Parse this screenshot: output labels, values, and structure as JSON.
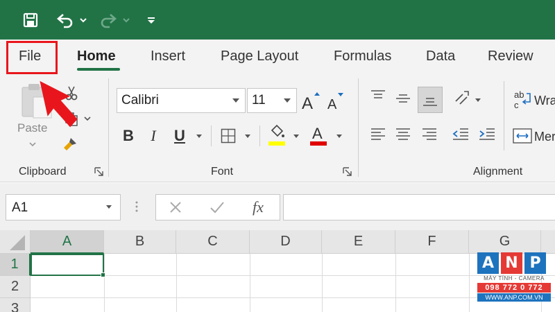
{
  "tabs": [
    {
      "label": "File",
      "active": false
    },
    {
      "label": "Home",
      "active": true
    },
    {
      "label": "Insert",
      "active": false
    },
    {
      "label": "Page Layout",
      "active": false
    },
    {
      "label": "Formulas",
      "active": false
    },
    {
      "label": "Data",
      "active": false
    },
    {
      "label": "Review",
      "active": false
    }
  ],
  "ribbon": {
    "clipboard": {
      "paste_label": "Paste",
      "group_label": "Clipboard"
    },
    "font": {
      "font_name": "Calibri",
      "font_size": "11",
      "group_label": "Font"
    },
    "alignment": {
      "wrap_label": "Wra",
      "merge_label": "Mer",
      "group_label": "Alignment"
    }
  },
  "formula_bar": {
    "name_box": "A1",
    "fx_label": "fx",
    "formula": ""
  },
  "grid": {
    "columns": [
      "A",
      "B",
      "C",
      "D",
      "E",
      "F",
      "G"
    ],
    "rows": [
      "1",
      "2",
      "3"
    ],
    "selected_cell": "A1"
  },
  "watermark": {
    "letters": [
      "A",
      "N",
      "P"
    ],
    "subtitle": "MÁY TÍNH - CAMERA",
    "phone": "098 772 0 772",
    "site": "WWW.ANP.COM.VN"
  },
  "colors": {
    "excel_green": "#217346",
    "highlight_red": "#e8161c",
    "font_highlight": "#ffff00",
    "font_color": "#e00000",
    "wm_blue": "#1e73be",
    "wm_red": "#e53935"
  },
  "icons": [
    "save-icon",
    "undo-icon",
    "redo-icon",
    "customize-icon",
    "paste-icon",
    "cut-icon",
    "copy-icon",
    "format-painter-icon",
    "bold-icon",
    "italic-icon",
    "underline-icon",
    "borders-icon",
    "fill-color-icon",
    "font-color-icon",
    "increase-font-icon",
    "decrease-font-icon",
    "align-top-icon",
    "align-middle-icon",
    "align-bottom-icon",
    "align-left-icon",
    "align-center-icon",
    "align-right-icon",
    "orientation-icon",
    "decrease-indent-icon",
    "increase-indent-icon",
    "wrap-text-icon",
    "merge-icon",
    "cancel-icon",
    "enter-icon",
    "function-icon",
    "arrow-pointer-icon"
  ]
}
